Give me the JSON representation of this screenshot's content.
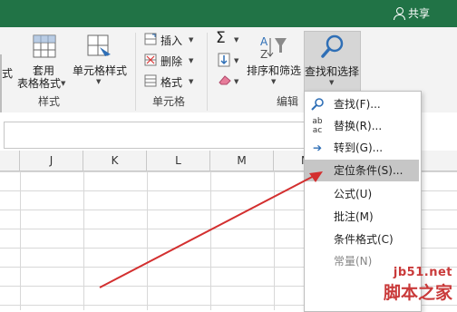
{
  "topbar": {
    "share_label": "共享"
  },
  "ribbon": {
    "partial_label": "式",
    "apply_table": {
      "line1": "套用",
      "line2": "表格格式"
    },
    "cell_style": {
      "line1": "单元格样式"
    },
    "styles_group": "样式",
    "insert_label": "插入",
    "delete_label": "删除",
    "format_label": "格式",
    "cells_group": "单元格",
    "sort_filter": {
      "line1": "排序和筛选"
    },
    "find_select": {
      "line1": "查找和选择"
    },
    "edit_group": "编辑"
  },
  "columns": [
    "J",
    "K",
    "L",
    "M",
    "N"
  ],
  "menu": {
    "items": [
      {
        "label": "查找(F)...",
        "icon": "magnifier-icon"
      },
      {
        "label": "替换(R)...",
        "icon": "replace-abc-icon"
      },
      {
        "label": "转到(G)...",
        "icon": "arrow-right-icon"
      },
      {
        "label": "定位条件(S)...",
        "icon": ""
      },
      {
        "label": "公式(U)",
        "icon": ""
      },
      {
        "label": "批注(M)",
        "icon": ""
      },
      {
        "label": "条件格式(C)",
        "icon": ""
      },
      {
        "label": "常量(N)",
        "icon": ""
      }
    ]
  },
  "watermark": {
    "line1": "jb51.net",
    "line2": "脚本之家"
  },
  "colors": {
    "accent": "#217346",
    "arrow": "#d32f2f"
  }
}
